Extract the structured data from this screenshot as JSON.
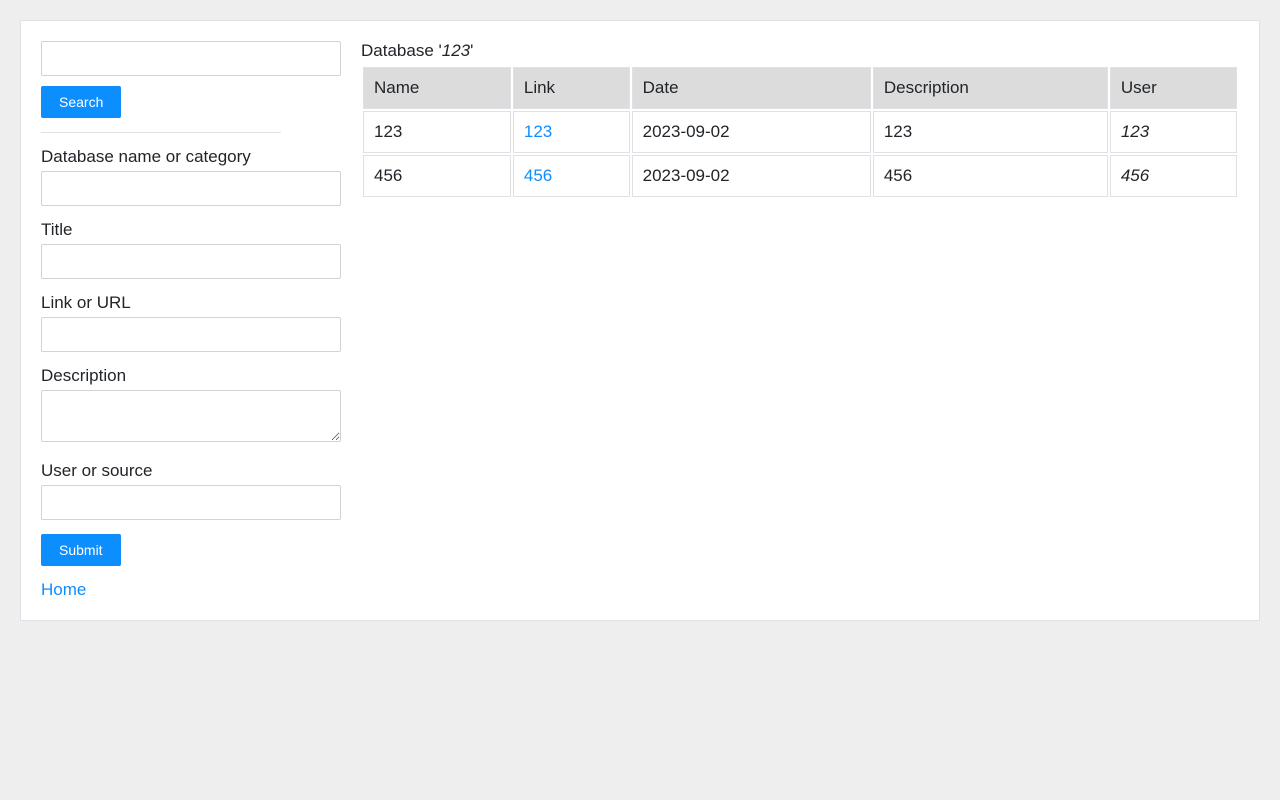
{
  "sidebar": {
    "search_button": "Search",
    "fields": {
      "database": "Database name or category",
      "title": "Title",
      "link": "Link or URL",
      "description": "Description",
      "user": "User or source"
    },
    "submit_button": "Submit",
    "home_link": "Home"
  },
  "main": {
    "title_prefix": "Database '",
    "title_db": "123",
    "title_suffix": "'",
    "columns": {
      "name": "Name",
      "link": "Link",
      "date": "Date",
      "description": "Description",
      "user": "User"
    },
    "rows": [
      {
        "name": "123",
        "link": "123",
        "date": "2023-09-02",
        "description": "123",
        "user": "123"
      },
      {
        "name": "456",
        "link": "456",
        "date": "2023-09-02",
        "description": "456",
        "user": "456"
      }
    ]
  }
}
